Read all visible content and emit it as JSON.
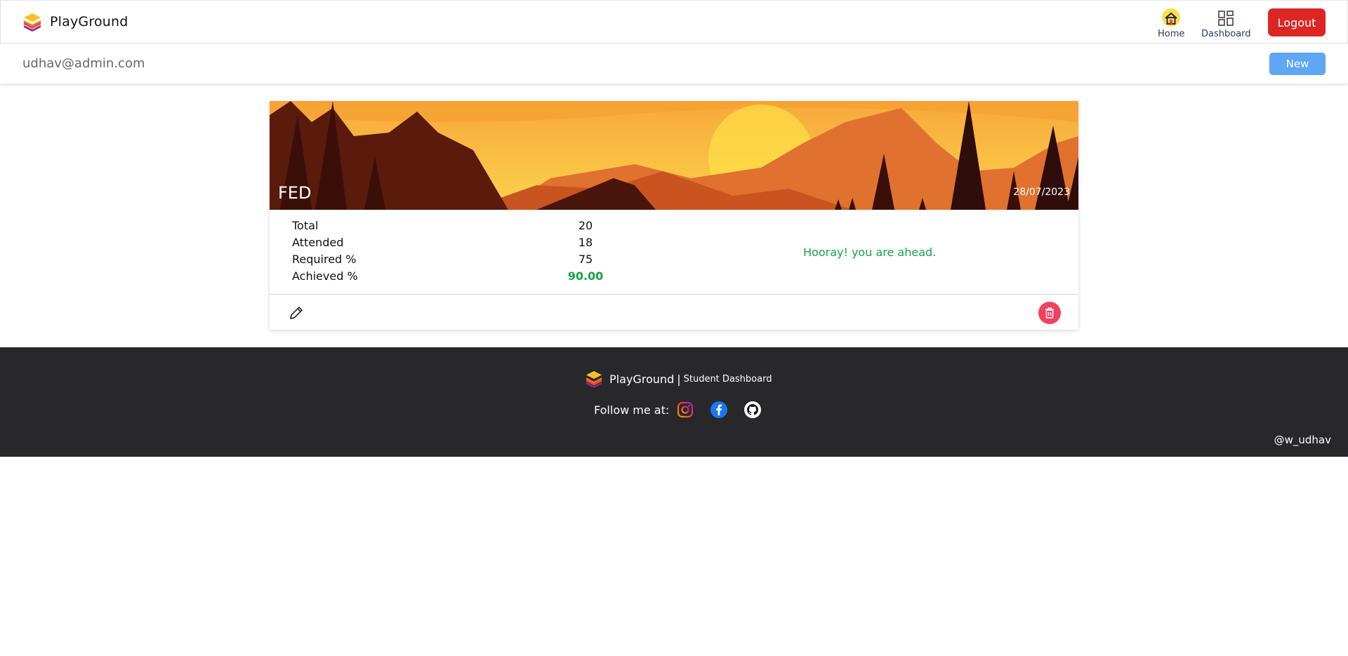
{
  "navbar": {
    "brand_name": "PlayGround",
    "links": [
      {
        "label": "Home",
        "icon": "home-icon"
      },
      {
        "label": "Dashboard",
        "icon": "dashboard-grid-icon"
      }
    ],
    "logout_label": "Logout"
  },
  "subbar": {
    "user_email": "udhav@admin.com",
    "new_label": "New"
  },
  "card": {
    "subject": "FED",
    "date": "28/07/2023",
    "stats": [
      {
        "label": "Total",
        "value": "20"
      },
      {
        "label": "Attended",
        "value": "18"
      },
      {
        "label": "Required %",
        "value": "75"
      },
      {
        "label": "Achieved %",
        "value": "90.00"
      }
    ],
    "status_message": "Hooray! you are ahead.",
    "achieved_color": "#16a34a",
    "delete_color": "#f43f5e"
  },
  "footer": {
    "brand_name": "PlayGround",
    "separator": "|",
    "tagline": "Student Dashboard",
    "follow_label": "Follow me at:",
    "socials": [
      "instagram-icon",
      "facebook-icon",
      "github-icon"
    ],
    "handle": "@w_udhav"
  },
  "colors": {
    "logout": "#dc2626",
    "new_button": "#5fa6f5",
    "footer_bg": "#28282a"
  }
}
